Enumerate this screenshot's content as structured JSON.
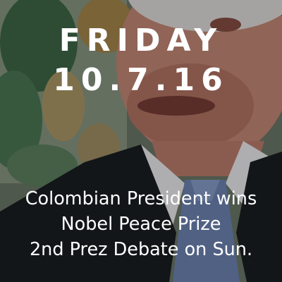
{
  "day_label": "FRIDAY",
  "date_label": "10.7.16",
  "headlines": [
    "Colombian President wins",
    "Nobel Peace Prize",
    "2nd Prez Debate on Sun."
  ],
  "colors": {
    "text": "#ffffff",
    "overlay": "#000000",
    "suit": "#1a1f22",
    "tie": "#6f87b8"
  }
}
